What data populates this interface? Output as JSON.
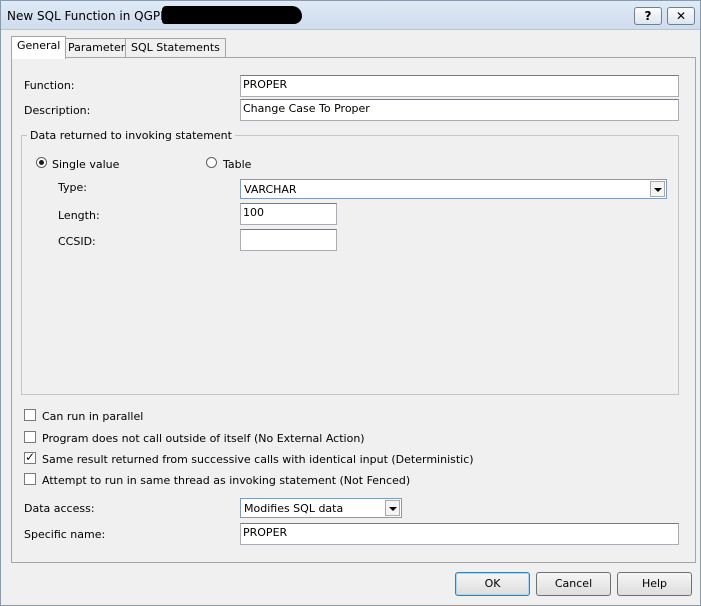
{
  "window": {
    "title": "New SQL Function in QGPL -",
    "help_button": "?",
    "close_button": "✕"
  },
  "tabs": [
    "General",
    "Parameters",
    "SQL Statements"
  ],
  "general": {
    "function_label": "Function:",
    "function_value": "PROPER",
    "description_label": "Description:",
    "description_value": "Change Case To Proper",
    "group_title": "Data returned to invoking statement",
    "radio_single": "Single value",
    "radio_table": "Table",
    "selected_return": "Single value",
    "type_label": "Type:",
    "type_value": "VARCHAR",
    "length_label": "Length:",
    "length_value": "100",
    "ccsid_label": "CCSID:",
    "ccsid_value": "",
    "options": [
      {
        "label": "Can run in parallel",
        "checked": false
      },
      {
        "label": "Program does not call outside of itself (No External Action)",
        "checked": false
      },
      {
        "label": "Same result returned from successive calls with identical input (Deterministic)",
        "checked": true
      },
      {
        "label": "Attempt to run in same thread as invoking statement (Not Fenced)",
        "checked": false
      }
    ],
    "data_access_label": "Data access:",
    "data_access_value": "Modifies SQL data",
    "specific_name_label": "Specific name:",
    "specific_name_value": "PROPER"
  },
  "buttons": {
    "ok": "OK",
    "cancel": "Cancel",
    "help": "Help"
  }
}
